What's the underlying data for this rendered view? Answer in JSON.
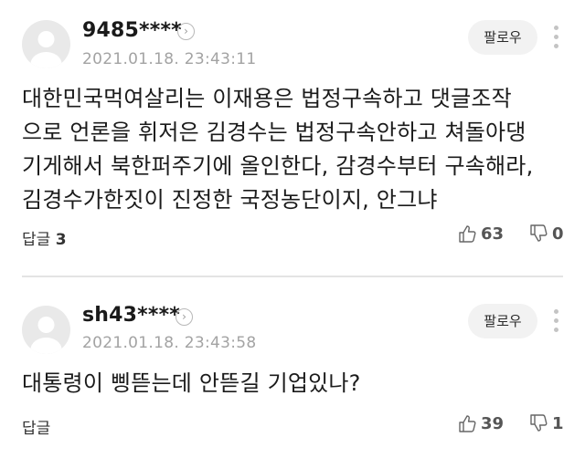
{
  "comments": [
    {
      "nickname": "9485****",
      "info_icon": "chevron-right-icon",
      "date": "2021.01.18. 23:43:11",
      "follow_label": "팔로우",
      "text": "대한민국먹여살리는 이재용은 법정구속하고 댓글조작\n으로 언론을 휘저은 김경수는 법정구속안하고 쳐돌아댕\n기게해서 북한퍼주기에 올인한다, 감경수부터 구속해라,\n김경수가한짓이 진정한 국정농단이지, 안그냐",
      "reply_label": "답글",
      "reply_count": "3",
      "likes": "63",
      "dislikes": "0"
    },
    {
      "nickname": "sh43****",
      "info_icon": "chevron-right-icon",
      "date": "2021.01.18. 23:43:58",
      "follow_label": "팔로우",
      "text": "대통령이 삥뜯는데 안뜯길 기업있나?",
      "reply_label": "답글",
      "reply_count": "",
      "likes": "39",
      "dislikes": "1"
    }
  ],
  "colors": {
    "nickname": "#1a1a1a",
    "date": "#a3a3a3",
    "follow_bg": "#f2f2f2",
    "avatar_bg": "#e9e9e9",
    "divider": "#e4e4e4"
  }
}
